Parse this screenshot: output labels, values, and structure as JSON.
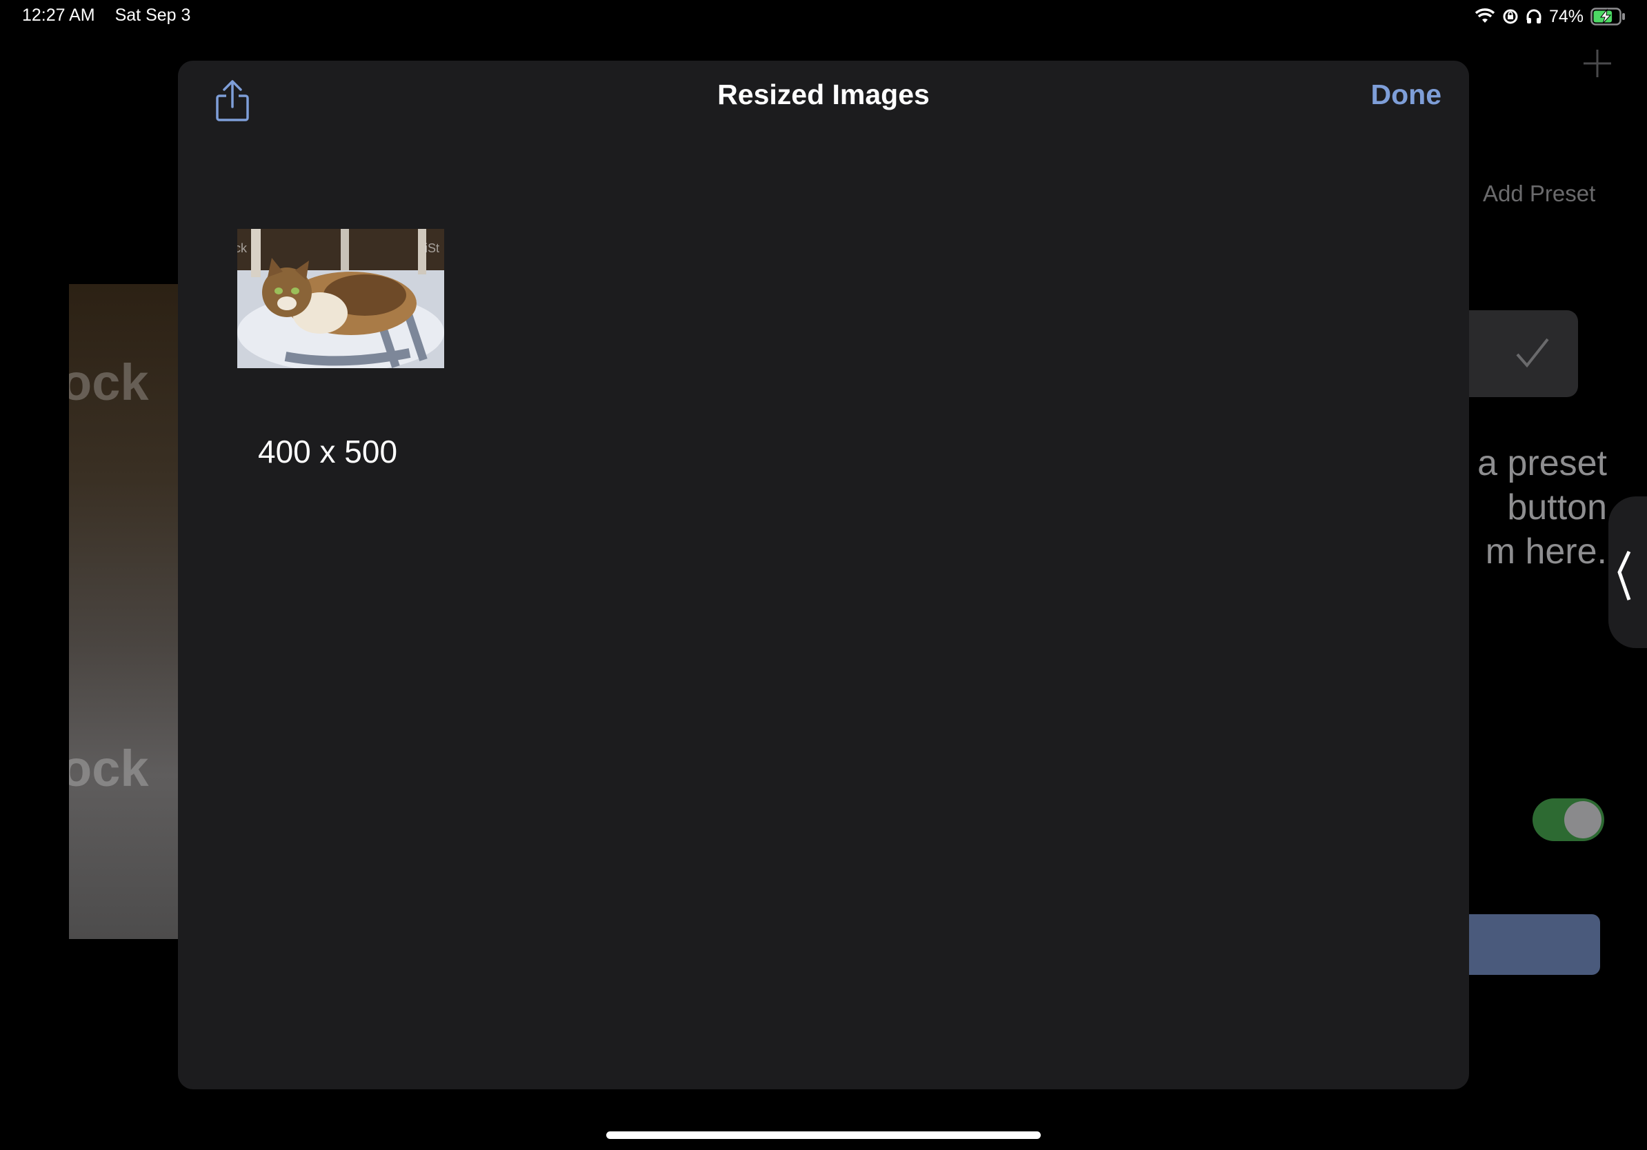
{
  "status_bar": {
    "time": "12:27 AM",
    "date": "Sat Sep 3",
    "battery_percent": "74%",
    "battery_level": 0.74,
    "icons": [
      "wifi-icon",
      "location-lock-icon",
      "headphones-icon",
      "battery-charging-icon"
    ]
  },
  "background_app": {
    "add_preset_label": "Add Preset",
    "hint_lines": [
      "a preset",
      "button",
      "m here."
    ],
    "toggle_on": true
  },
  "modal": {
    "title": "Resized Images",
    "done_label": "Done",
    "share_icon": "share-icon",
    "accent_color": "#7e9ed8",
    "images": [
      {
        "caption": "400 x 500",
        "thumbnail": "cat-photo"
      }
    ]
  },
  "colors": {
    "modal_background": "#1c1c1e",
    "toggle_on": "#2d6a32",
    "button_blue": "#4a5a7c"
  }
}
